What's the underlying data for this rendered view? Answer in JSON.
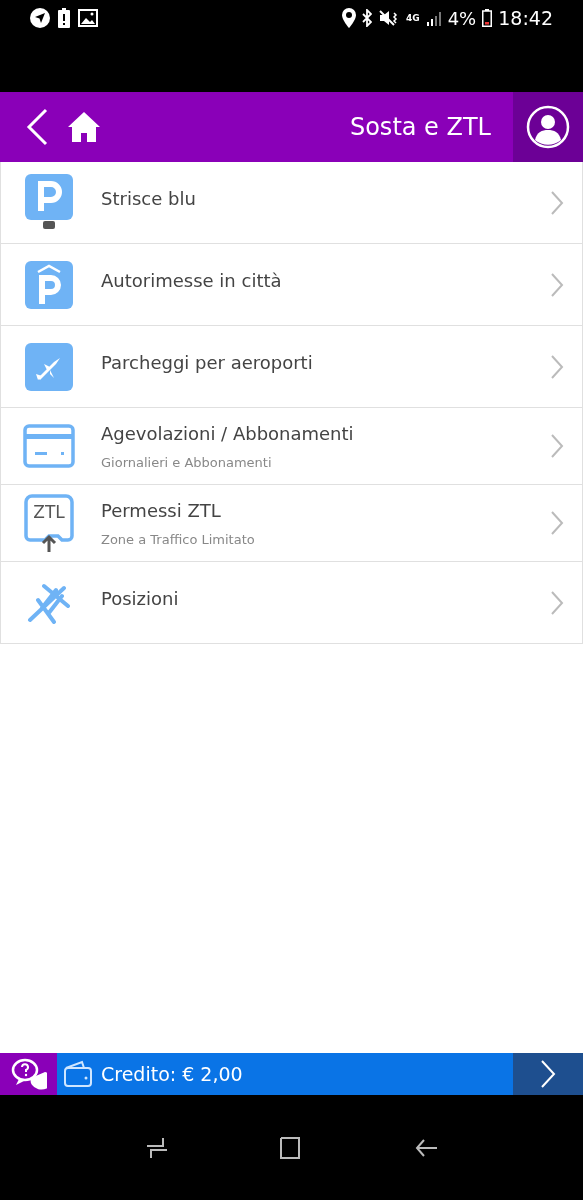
{
  "status_bar": {
    "network": "4G",
    "battery": "4%",
    "time": "18:42"
  },
  "header": {
    "title": "Sosta e ZTL"
  },
  "menu": [
    {
      "kind": "meter",
      "label": "Strisce blu"
    },
    {
      "kind": "garage",
      "label": "Autorimesse in città"
    },
    {
      "kind": "airport",
      "label": "Parcheggi per aeroporti"
    },
    {
      "kind": "card",
      "label": "Agevolazioni / Abbonamenti",
      "subtitle": "Giornalieri e Abbonamenti"
    },
    {
      "kind": "ztl",
      "label": "Permessi ZTL",
      "subtitle": "Zone a Traffico Limitato",
      "icon_text": "ZTL"
    },
    {
      "kind": "pin",
      "label": "Posizioni"
    }
  ],
  "credit_bar": {
    "label": "Credito: € 2,00"
  }
}
